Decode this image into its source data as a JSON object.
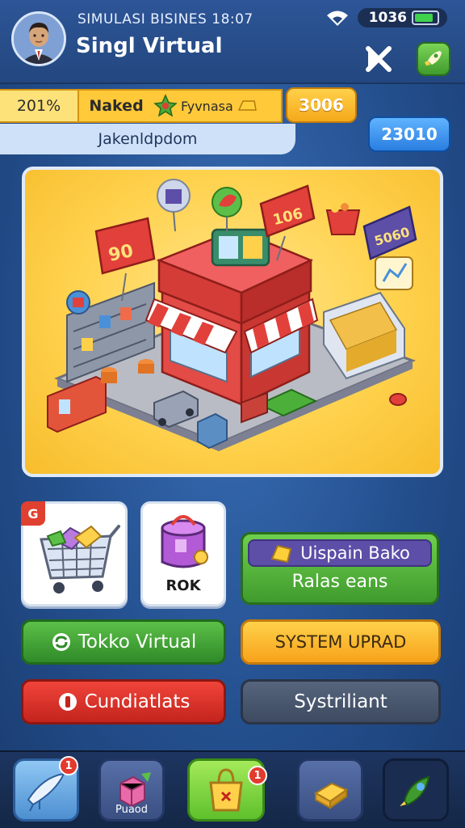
{
  "header": {
    "game_title": "SIMULASI BISINES 18:07",
    "player_name": "Singl Virtual",
    "status_time": "1036"
  },
  "resources": {
    "percent": "201%",
    "label": "Naked",
    "currency_name": "Fyvnasa",
    "coins": "3006",
    "location": "Jakenldpdom",
    "gems": "23010"
  },
  "scene": {
    "price_tags": [
      "90",
      "106",
      "5060"
    ]
  },
  "cards": {
    "cart_badge": "G",
    "rok_label": "ROK"
  },
  "promo": {
    "title": "Uispain Bako",
    "subtitle": "Ralas eans"
  },
  "buttons": {
    "store": "Tokko Virtual",
    "upgrade": "SYSTEM UPRAD",
    "candidates": "Cundiatlats",
    "system": "Systriliant"
  },
  "nav": {
    "item1_badge": "1",
    "item2_label": "Puaod",
    "item3_badge": "1"
  },
  "colors": {
    "background": "#2a5ca4",
    "accent_yellow": "#ffc93a",
    "accent_green": "#4caf3a",
    "accent_red": "#e0342a"
  }
}
